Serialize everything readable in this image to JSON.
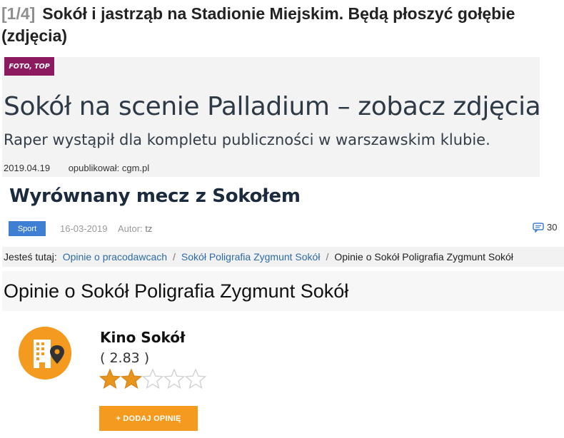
{
  "gallery_item": {
    "counter": "[1/4]",
    "title": "Sokół i jastrząb na Stadionie Miejskim. Będą płoszyć gołębie (zdjęcia)"
  },
  "article_card": {
    "badge": "FOTO, TOP",
    "headline": "Sokół na scenie Palladium – zobacz zdjęcia",
    "lead": "Raper wystąpił dla kompletu publiczności w warszawskim klubie.",
    "date": "2019.04.19",
    "author": "opublikował: cgm.pl",
    "badge_color": "#8c1a5e"
  },
  "sport_article": {
    "title": "Wyrównany mecz z Sokołem",
    "category": "Sport",
    "date": "16-03-2019",
    "author_label": "Autor:",
    "author": "tz",
    "comments": "30",
    "category_color": "#3f7fd3"
  },
  "opinions_page": {
    "breadcrumb": {
      "label": "Jesteś tutaj:",
      "items": [
        "Opinie o pracodawcach",
        "Sokół Poligrafia Zygmunt Sokół"
      ],
      "current": "Opinie o Sokół Poligrafia Zygmunt Sokół"
    },
    "heading": "Opinie o Sokół Poligrafia Zygmunt Sokół",
    "company": {
      "name": "Kino Sokół",
      "score": "( 2.83 )",
      "rating": 2.83,
      "max_rating": 5,
      "icon": "building-location-icon"
    },
    "add_button": "+ DODAJ OPINIĘ",
    "accent_color": "#f49a1f"
  }
}
